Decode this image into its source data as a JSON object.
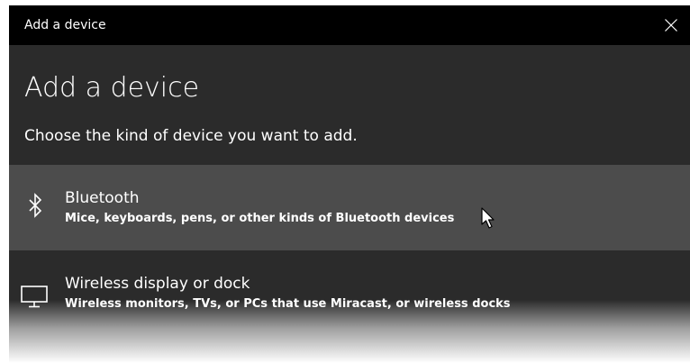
{
  "window": {
    "title": "Add a device",
    "close_icon": "close-icon"
  },
  "page": {
    "heading": "Add a device",
    "instruction": "Choose the kind of device you want to add."
  },
  "devices": [
    {
      "icon": "bluetooth-icon",
      "title": "Bluetooth",
      "description": "Mice, keyboards, pens, or other kinds of Bluetooth devices",
      "hovered": true
    },
    {
      "icon": "monitor-icon",
      "title": "Wireless display or dock",
      "description": "Wireless monitors, TVs, or PCs that use Miracast, or wireless docks",
      "hovered": false
    }
  ],
  "colors": {
    "titlebar": "#000000",
    "background": "#2b2b2b",
    "hover_row": "#4c4c4c",
    "text": "#ffffff"
  }
}
